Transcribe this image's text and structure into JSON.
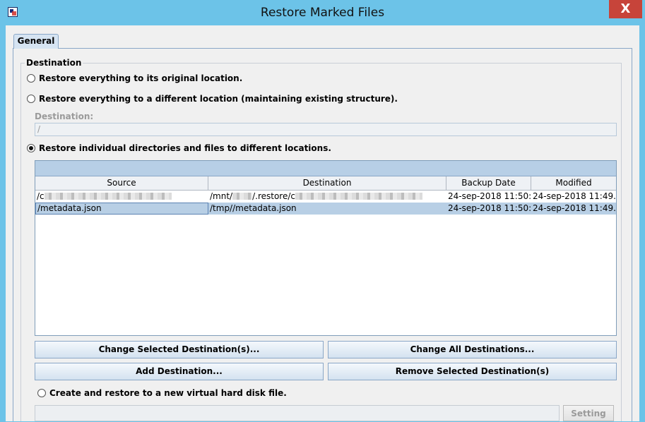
{
  "window": {
    "title": "Restore Marked Files",
    "close_glyph": "X"
  },
  "tabs": [
    {
      "label": "General"
    }
  ],
  "destination_group": {
    "legend": "Destination",
    "options": [
      {
        "label": "Restore everything to its original location.",
        "checked": false
      },
      {
        "label": "Restore everything to a different location (maintaining existing structure).",
        "checked": false
      },
      {
        "label": "Restore individual directories and files to different locations.",
        "checked": true
      }
    ],
    "destination_field": {
      "label": "Destination:",
      "value": "/"
    }
  },
  "table": {
    "columns": [
      "Source",
      "Destination",
      "Backup Date",
      "Modified"
    ],
    "rows": [
      {
        "source": "/c",
        "destination": "/mnt/",
        "destination_tail": "/.restore/c",
        "backup_date": "24-sep-2018 11:50:...",
        "modified": "24-sep-2018 11:49..."
      },
      {
        "source": "/metadata.json",
        "destination": "/tmp//metadata.json",
        "backup_date": "24-sep-2018 11:50:...",
        "modified": "24-sep-2018 11:49..."
      }
    ]
  },
  "buttons": {
    "change_selected": "Change Selected Destination(s)...",
    "change_all": "Change All Destinations...",
    "add_destination": "Add Destination...",
    "remove_selected": "Remove Selected Destination(s)",
    "setting": "Setting"
  },
  "vhd_option": {
    "label": "Create and restore to a new virtual hard disk file.",
    "checked": false
  }
}
